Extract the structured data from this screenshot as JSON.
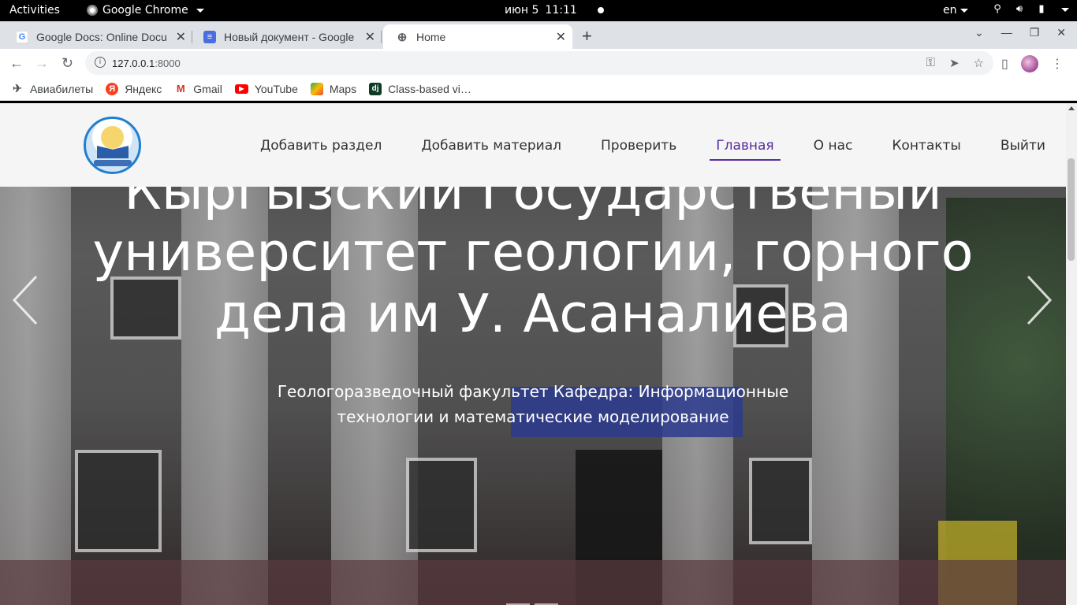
{
  "topbar": {
    "activities": "Activities",
    "app_name": "Google Chrome",
    "date": "июн 5",
    "time": "11:11",
    "lang": "en"
  },
  "tabs": [
    {
      "title": "Google Docs: Online Docu",
      "icon": "google-icon"
    },
    {
      "title": "Новый документ - Google",
      "icon": "docs-icon"
    },
    {
      "title": "Home",
      "icon": "globe-icon",
      "active": true
    }
  ],
  "address": {
    "host": "127.0.0.1",
    "port": ":8000"
  },
  "bookmarks": [
    {
      "label": "Авиабилеты",
      "icon": "plane-icon"
    },
    {
      "label": "Яндекс",
      "icon": "yandex-icon"
    },
    {
      "label": "Gmail",
      "icon": "gmail-icon"
    },
    {
      "label": "YouTube",
      "icon": "youtube-icon"
    },
    {
      "label": "Maps",
      "icon": "maps-icon"
    },
    {
      "label": "Class-based vi…",
      "icon": "django-icon"
    }
  ],
  "site": {
    "nav": [
      {
        "label": "Добавить раздел"
      },
      {
        "label": "Добавить материал"
      },
      {
        "label": "Проверить"
      },
      {
        "label": "Главная",
        "active": true
      },
      {
        "label": "О нас"
      },
      {
        "label": "Контакты"
      },
      {
        "label": "Выйти"
      }
    ],
    "hero": {
      "title_lines": [
        "Кыргызский Государственый",
        "университет геологии, горного",
        "дела им У. Асаналиева"
      ],
      "subtitle": "Геологоразведочный факультет Кафедра: Информационные технологии и математические моделирование"
    }
  },
  "colors": {
    "nav_active": "#5a2ca0",
    "header_bg": "#f5f5f5",
    "tabstrip_bg": "#dee1e6"
  }
}
